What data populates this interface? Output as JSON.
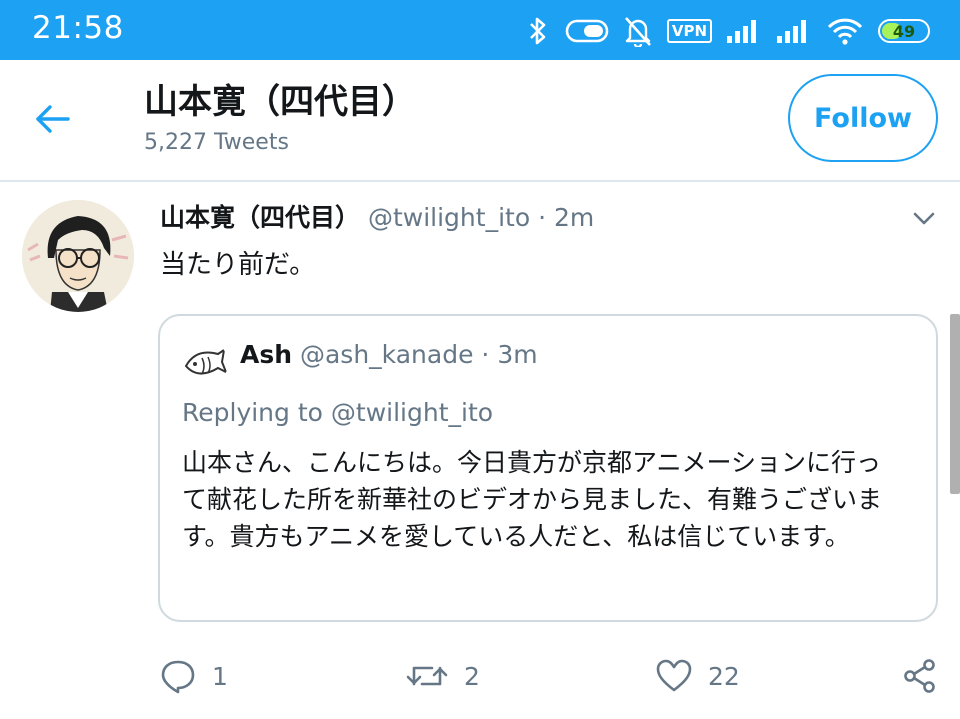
{
  "status_bar": {
    "time": "21:58",
    "vpn": "VPN",
    "battery": "49",
    "battery_level": 0.49
  },
  "header": {
    "name": "山本寛（四代目）",
    "tweet_count": "5,227 Tweets",
    "follow_label": "Follow"
  },
  "tweet": {
    "author_name": "山本寛（四代目）",
    "handle": "@twilight_ito",
    "separator": "·",
    "time": "2m",
    "text": "当たり前だ。",
    "quoted": {
      "author_name": "Ash",
      "handle": "@ash_kanade",
      "separator": "·",
      "time": "3m",
      "replying_to": "Replying to @twilight_ito",
      "text": "山本さん、こんにちは。今日貴方が京都アニメーションに行って献花した所を新華社のビデオから見ました、有難うございます。貴方もアニメを愛している人だと、私は信じています。"
    },
    "actions": {
      "replies": "1",
      "retweets": "2",
      "likes": "22"
    }
  },
  "colors": {
    "accent": "#1da1f2",
    "secondary_text": "#657786",
    "border": "#cfd9de",
    "battery_fill": "#a8f25b"
  }
}
